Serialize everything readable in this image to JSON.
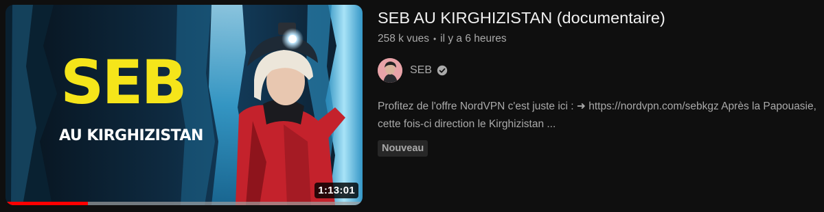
{
  "thumbnail": {
    "title_text": "SEB",
    "subtitle_text": "AU KIRGHIZISTAN",
    "duration": "1:13:01",
    "watch_progress_percent": 23
  },
  "video": {
    "title": "SEB AU KIRGHIZISTAN (documentaire)",
    "views": "258 k vues",
    "separator": "•",
    "published": "il y a 6 heures"
  },
  "channel": {
    "name": "SEB",
    "verified_icon": "verified-check-icon",
    "avatar_color": "#e8a3a8"
  },
  "description": "Profitez de l'offre NordVPN c'est juste ici : ➜ https://nordvpn.com/sebkgz Après la Papouasie, cette fois-ci direction le Kirghizistan ...",
  "badges": {
    "new_label": "Nouveau"
  },
  "colors": {
    "background": "#0f0f0f",
    "title_yellow": "#f5e51a",
    "progress_red": "#ff0000",
    "meta_gray": "#aaaaaa"
  }
}
